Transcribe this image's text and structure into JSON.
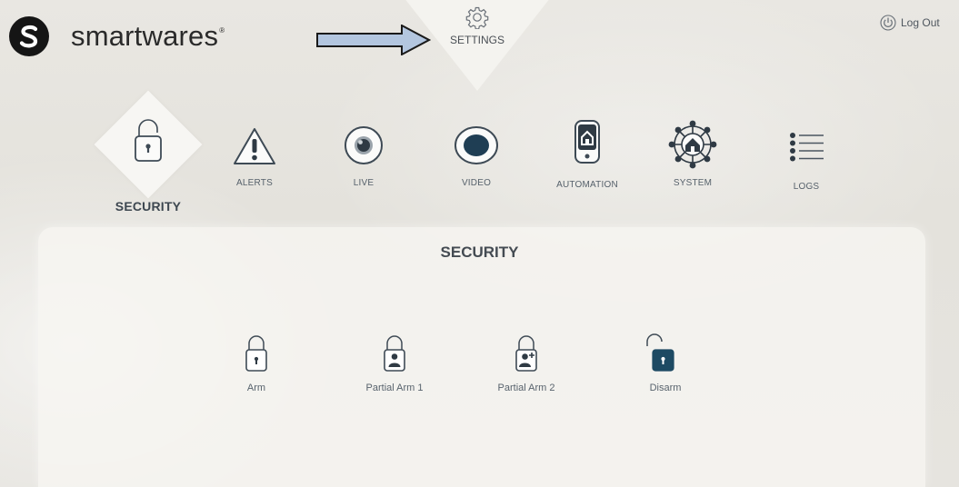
{
  "header": {
    "brand": "smartwares",
    "brand_badge": "S",
    "settings_label": "SETTINGS",
    "logout_label": "Log Out"
  },
  "nav": {
    "items": [
      {
        "id": "security",
        "label": "SECURITY",
        "icon": "lock-icon",
        "active": true
      },
      {
        "id": "alerts",
        "label": "ALERTS",
        "icon": "warning-icon"
      },
      {
        "id": "live",
        "label": "LIVE",
        "icon": "eye-icon"
      },
      {
        "id": "video",
        "label": "VIDEO",
        "icon": "record-icon"
      },
      {
        "id": "automation",
        "label": "AUTOMATION",
        "icon": "smart-home-device-icon"
      },
      {
        "id": "system",
        "label": "SYSTEM",
        "icon": "home-network-icon"
      },
      {
        "id": "logs",
        "label": "LOGS",
        "icon": "list-icon"
      }
    ]
  },
  "panel": {
    "title": "SECURITY",
    "modes": [
      {
        "id": "arm",
        "label": "Arm",
        "icon": "lock-closed-icon"
      },
      {
        "id": "partial_arm_1",
        "label": "Partial Arm 1",
        "icon": "lock-user-icon"
      },
      {
        "id": "partial_arm_2",
        "label": "Partial Arm 2",
        "icon": "lock-user-plus-icon"
      },
      {
        "id": "disarm",
        "label": "Disarm",
        "icon": "lock-open-icon",
        "active": true
      }
    ]
  },
  "colors": {
    "accent_dark": "#1d4a63",
    "icon_stroke": "#3e4a55",
    "arrow_fill": "#b3c6df",
    "arrow_stroke": "#1a1a1a"
  }
}
